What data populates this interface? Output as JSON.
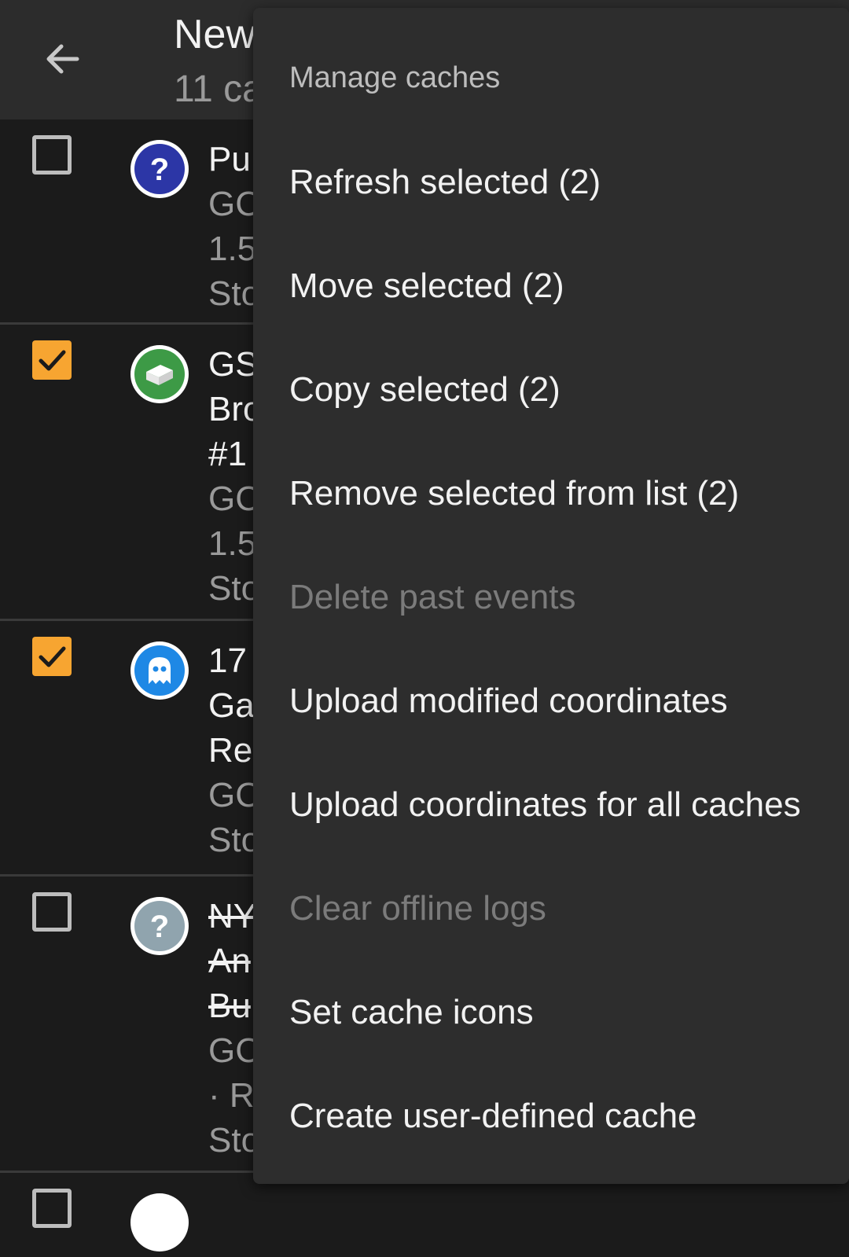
{
  "header": {
    "title": "New",
    "subtitle": "11 ca"
  },
  "rows": [
    {
      "checked": false,
      "icon": "mystery-cache-icon",
      "icon_color": "#2c36a6",
      "lines": [
        "Pu",
        "GC",
        "1.5",
        "Sto"
      ]
    },
    {
      "checked": true,
      "icon": "traditional-cache-icon",
      "icon_color": "#3d9a46",
      "lines": [
        "GS",
        "Bro",
        "#1",
        "GC",
        "1.5",
        "Sto"
      ]
    },
    {
      "checked": true,
      "icon": "virtual-cache-icon",
      "icon_color": "#1e88e5",
      "lines": [
        "17",
        "Ga",
        "Re",
        "GC",
        "Sto"
      ]
    },
    {
      "checked": false,
      "icon": "mystery-cache-icon",
      "icon_color": "#90a4ae",
      "lines": [
        "NY",
        "An",
        "Bu",
        "GC",
        "· Re",
        "Sto"
      ]
    }
  ],
  "menu": {
    "header": "Manage caches",
    "items": [
      {
        "label": "Refresh selected (2)",
        "enabled": true
      },
      {
        "label": "Move selected (2)",
        "enabled": true
      },
      {
        "label": "Copy selected (2)",
        "enabled": true
      },
      {
        "label": "Remove selected from list (2)",
        "enabled": true
      },
      {
        "label": "Delete past events",
        "enabled": false
      },
      {
        "label": "Upload modified coordinates",
        "enabled": true
      },
      {
        "label": "Upload coordinates for all caches",
        "enabled": true
      },
      {
        "label": "Clear offline logs",
        "enabled": false
      },
      {
        "label": "Set cache icons",
        "enabled": true
      },
      {
        "label": "Create user-defined cache",
        "enabled": true
      }
    ]
  },
  "colors": {
    "accent": "#f7a531",
    "menu_bg": "#2d2d2d",
    "list_bg": "#1b1b1b"
  }
}
